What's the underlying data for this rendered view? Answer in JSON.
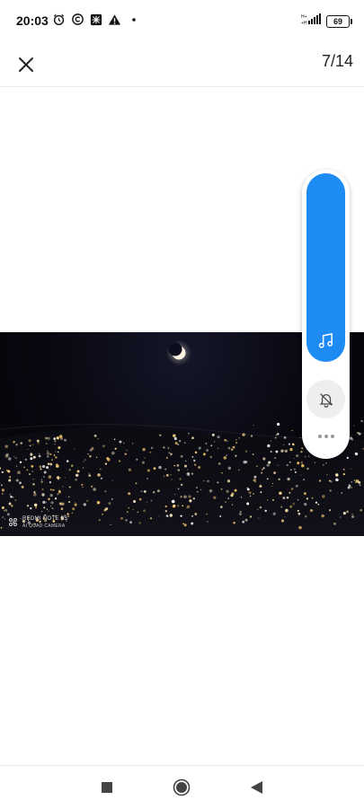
{
  "status_bar": {
    "time": "20:03",
    "battery": "69",
    "icons": [
      "alarm-icon",
      "copyright-icon",
      "app-notification-icon",
      "warning-icon",
      "dot-icon",
      "signal-icon"
    ]
  },
  "header": {
    "counter": "7/14",
    "close_icon": "close-icon"
  },
  "photo": {
    "watermark_line1": "REDMI NOTE 9S",
    "watermark_line2": "AI QUAD CAMERA"
  },
  "side_panel": {
    "music_icon": "music-note-icon",
    "bell_icon": "bell-off-icon",
    "more_icon": "more-dots-icon",
    "accent_color": "#1e8bf5"
  },
  "nav_bar": {
    "buttons": [
      "recent-apps-square-icon",
      "home-circle-icon",
      "back-triangle-icon"
    ]
  }
}
